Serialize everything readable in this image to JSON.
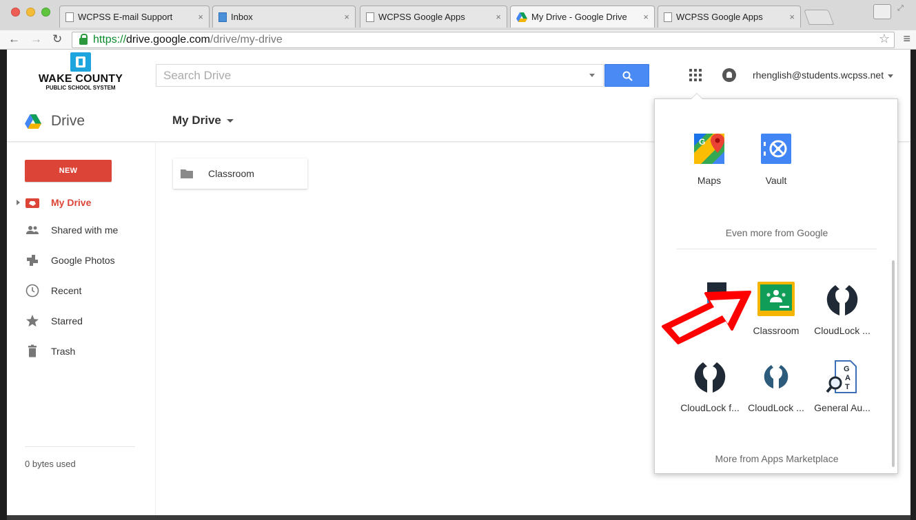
{
  "browser": {
    "tabs": [
      {
        "label": "WCPSS E-mail Support",
        "favicon": "page-icon"
      },
      {
        "label": "Inbox",
        "favicon": "inbox-icon"
      },
      {
        "label": "WCPSS Google Apps",
        "favicon": "page-icon"
      },
      {
        "label": "My Drive - Google Drive",
        "favicon": "drive-icon",
        "active": true
      },
      {
        "label": "WCPSS Google Apps",
        "favicon": "page-icon"
      }
    ],
    "close_glyph": "×",
    "url": {
      "scheme": "https://",
      "host": "drive.google.com",
      "path": "/drive/my-drive"
    }
  },
  "header": {
    "logo": {
      "line1": "WAKE COUNTY",
      "line2": "PUBLIC SCHOOL SYSTEM"
    },
    "search_placeholder": "Search Drive",
    "account": "rhenglish@students.wcpss.net"
  },
  "subbar": {
    "app_name": "Drive",
    "location": "My Drive"
  },
  "sidebar": {
    "new_label": "NEW",
    "items": [
      {
        "label": "My Drive",
        "icon": "my-drive-icon",
        "active": true
      },
      {
        "label": "Shared with me",
        "icon": "people-icon"
      },
      {
        "label": "Google Photos",
        "icon": "photos-icon"
      },
      {
        "label": "Recent",
        "icon": "clock-icon"
      },
      {
        "label": "Starred",
        "icon": "star-icon"
      },
      {
        "label": "Trash",
        "icon": "trash-icon"
      }
    ],
    "storage": "0 bytes used"
  },
  "files": [
    {
      "name": "Classroom",
      "type": "folder"
    }
  ],
  "apps_panel": {
    "top_apps": [
      {
        "label": "Maps",
        "icon": "maps-icon"
      },
      {
        "label": "Vault",
        "icon": "vault-icon"
      }
    ],
    "even_more": "Even more from Google",
    "marketplace_apps": [
      {
        "label": "",
        "icon": "partial-app-icon"
      },
      {
        "label": "Classroom",
        "icon": "classroom-icon"
      },
      {
        "label": "CloudLock ...",
        "icon": "cloudlock-icon"
      },
      {
        "label": "CloudLock f...",
        "icon": "cloudlock-icon"
      },
      {
        "label": "CloudLock ...",
        "icon": "cloudlock-icon"
      },
      {
        "label": "General Au...",
        "icon": "gat-icon"
      }
    ],
    "more_marketplace": "More from Apps Marketplace"
  },
  "colors": {
    "accent_red": "#db4437",
    "search_blue": "#4a8af4",
    "annotation_arrow": "#ff0000"
  }
}
